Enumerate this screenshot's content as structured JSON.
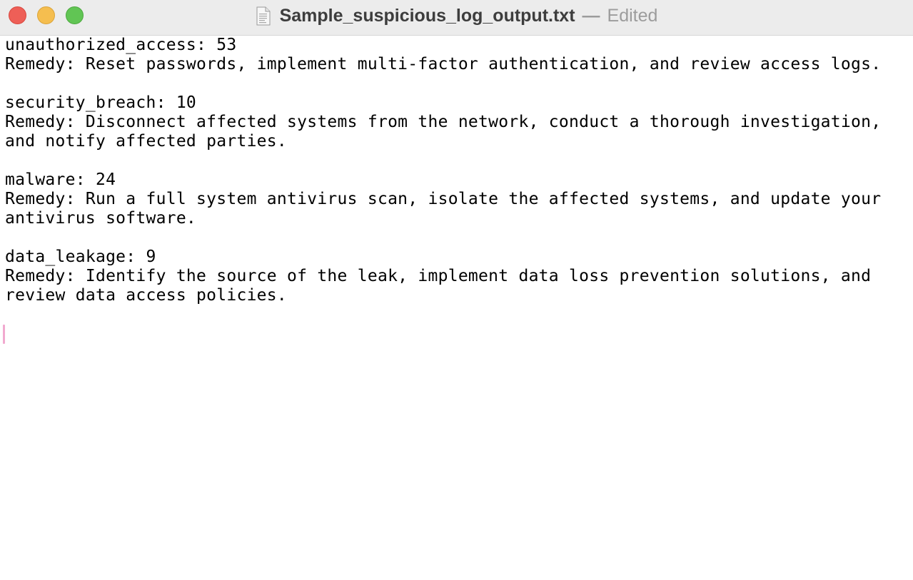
{
  "window": {
    "title": "Sample_suspicious_log_output.txt",
    "separator": "—",
    "status": "Edited",
    "file_icon": "text-document-icon",
    "controls": [
      "close-button",
      "minimize-button",
      "zoom-button"
    ],
    "control_colors": {
      "close": "#ee5f57",
      "minimize": "#f5be4f",
      "zoom": "#61c554"
    }
  },
  "document": {
    "lines": [
      "unauthorized_access: 53",
      "Remedy: Reset passwords, implement multi-factor authentication, and review access logs.",
      "",
      "security_breach: 10",
      "Remedy: Disconnect affected systems from the network, conduct a thorough investigation,",
      "and notify affected parties.",
      "",
      "malware: 24",
      "Remedy: Run a full system antivirus scan, isolate the affected systems, and update your",
      "antivirus software.",
      "",
      "data_leakage: 9",
      "Remedy: Identify the source of the leak, implement data loss prevention solutions, and",
      "review data access policies.",
      "",
      ""
    ],
    "cursor_color": "#f1a9cf"
  }
}
